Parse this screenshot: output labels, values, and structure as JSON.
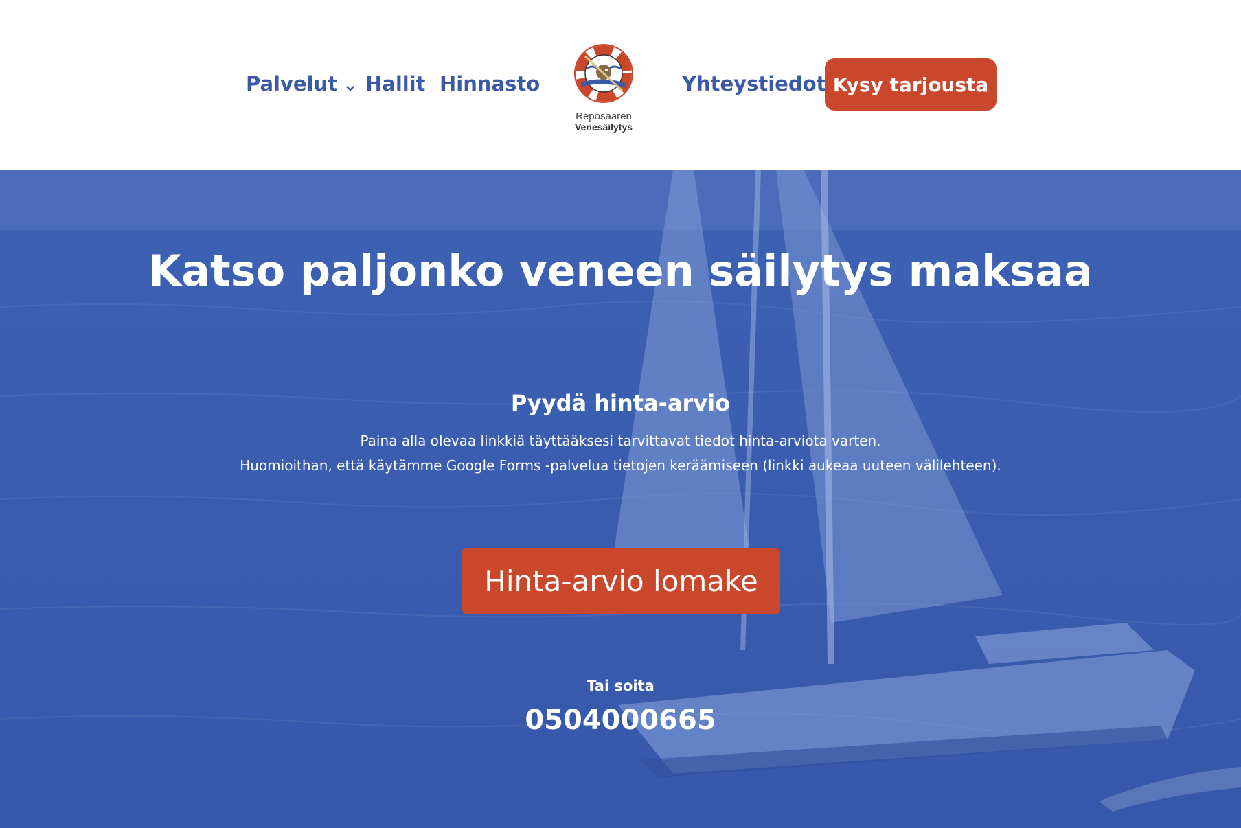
{
  "header": {
    "nav": {
      "palvelut": "Palvelut",
      "hallit": "Hallit",
      "hinnasto": "Hinnasto",
      "yhteystiedot": "Yhteystiedot"
    },
    "cta": "Kysy tarjousta",
    "logo": {
      "line1": "Reposaaren",
      "line2": "Venesäilytys"
    }
  },
  "hero": {
    "title": "Katso paljonko veneen säilytys maksaa",
    "subtitle": "Pyydä hinta-arvio",
    "description_line1": "Paina alla olevaa linkkiä täyttääksesi tarvittavat tiedot hinta-arviota varten.",
    "description_line2": "Huomioithan, että käytämme Google Forms -palvelua tietojen keräämiseen (linkki aukeaa uuteen välilehteen).",
    "button": "Hinta-arvio lomake",
    "or_call": "Tai soita",
    "phone": "0504000665"
  },
  "colors": {
    "brand_blue": "#3b5aa6",
    "hero_blue": "#3e63b4",
    "accent_orange": "#c9472a"
  }
}
